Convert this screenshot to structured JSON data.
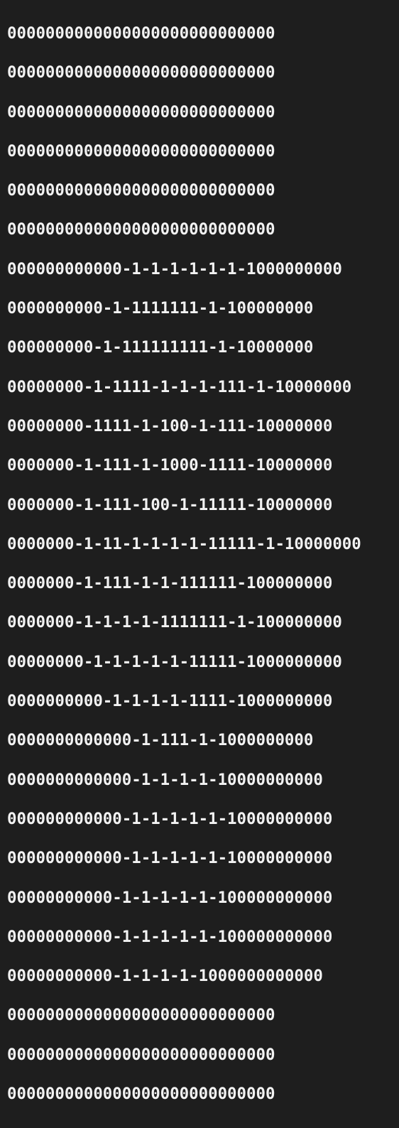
{
  "output": {
    "lines": [
      "0000000000000000000000000000",
      "0000000000000000000000000000",
      "0000000000000000000000000000",
      "0000000000000000000000000000",
      "0000000000000000000000000000",
      "0000000000000000000000000000",
      "000000000000-1-1-1-1-1-1-1000000000",
      "0000000000-1-1111111-1-100000000",
      "000000000-1-111111111-1-10000000",
      "00000000-1-1111-1-1-1-111-1-10000000",
      "00000000-1111-1-100-1-111-10000000",
      "0000000-1-111-1-1000-1111-10000000",
      "0000000-1-111-100-1-11111-10000000",
      "0000000-1-11-1-1-1-1-11111-1-10000000",
      "0000000-1-111-1-1-111111-100000000",
      "0000000-1-1-1-1-1111111-1-100000000",
      "00000000-1-1-1-1-1-11111-1000000000",
      "0000000000-1-1-1-1-1111-1000000000",
      "0000000000000-1-111-1-1000000000",
      "0000000000000-1-1-1-1-10000000000",
      "000000000000-1-1-1-1-1-10000000000",
      "000000000000-1-1-1-1-1-10000000000",
      "00000000000-1-1-1-1-1-100000000000",
      "00000000000-1-1-1-1-1-100000000000",
      "00000000000-1-1-1-1-1000000000000",
      "0000000000000000000000000000",
      "0000000000000000000000000000",
      "0000000000000000000000000000"
    ]
  }
}
